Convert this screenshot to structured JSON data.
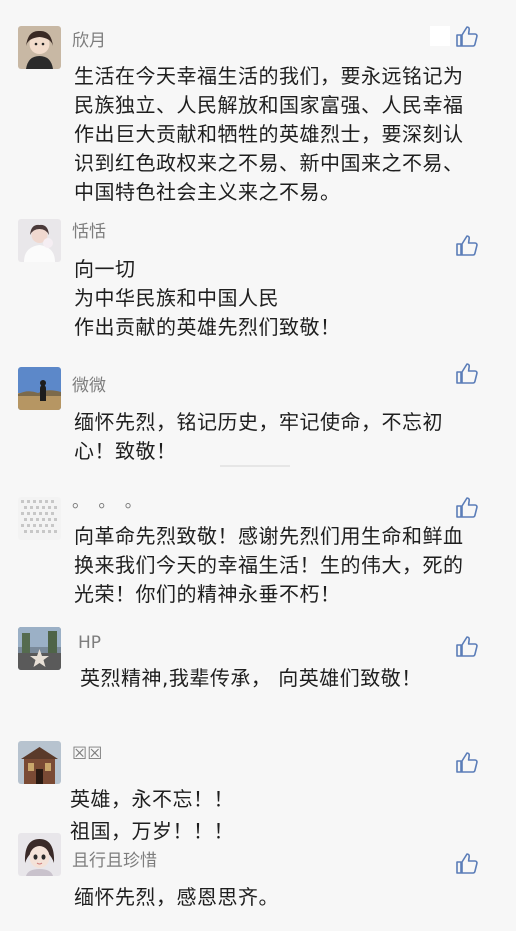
{
  "comments": [
    {
      "name": "欣月",
      "avatar": "girl-avatar-icon",
      "text": "生活在今天幸福生活的我们，要永远铭记为\n民族独立、人民解放和国家富强、人民幸福\n作出巨大贡献和牺牲的英雄烈士，要深刻认\n识到红色政权来之不易、新中国来之不易、\n中国特色社会主义来之不易。"
    },
    {
      "name": "恬恬",
      "avatar": "bride-avatar-icon",
      "text": "向一切\n为中华民族和中国人民\n作出贡献的英雄先烈们致敬！"
    },
    {
      "name": "微微",
      "avatar": "landscape-avatar-icon",
      "text": "缅怀先烈，铭记历史，牢记使命，不忘初\n心！致敬！"
    },
    {
      "name": "。 。 。",
      "avatar": "pattern-avatar-icon",
      "text": "向革命先烈致敬！感谢先烈们用生命和鲜血\n换来我们今天的幸福生活！生的伟大，死的\n光荣！你们的精神永垂不朽！"
    },
    {
      "name": "HP",
      "avatar": "star-avatar-icon",
      "text": "英烈精神,我辈传承， 向英雄们致敬！"
    },
    {
      "name": "☒☒",
      "avatar": "building-avatar-icon",
      "text": "英雄，永不忘！！\n祖国，万岁！！！"
    },
    {
      "name": "且行且珍惜",
      "avatar": "cartoon-girl-avatar-icon",
      "text": "缅怀先烈，感恩思齐。"
    }
  ],
  "colors": {
    "background": "#f7f7f7",
    "name": "#7d7d7d",
    "text": "#1e1e1e",
    "like_icon": "#5b7db8"
  },
  "like_icon": "thumbs-up-icon"
}
